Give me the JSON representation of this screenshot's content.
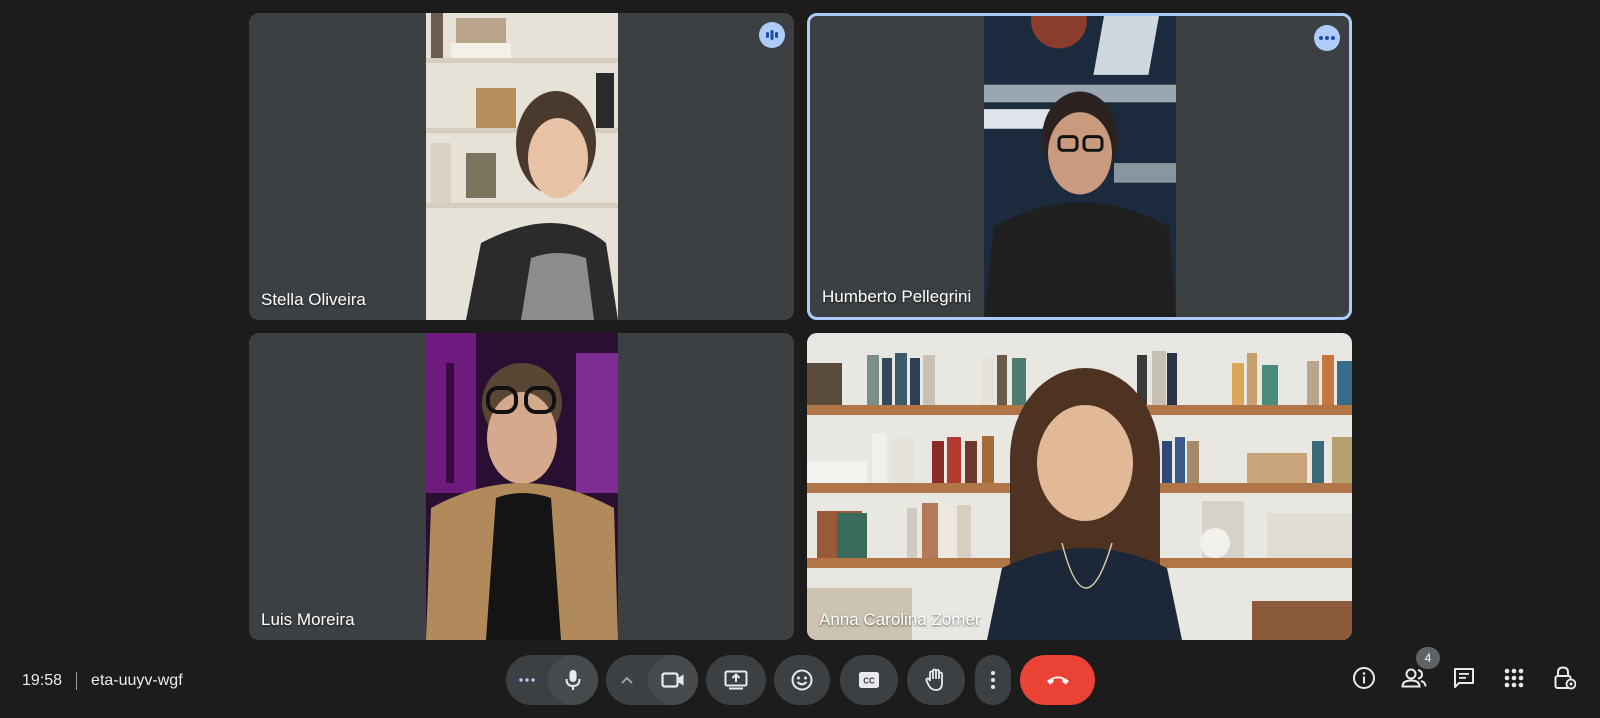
{
  "participants": [
    {
      "name": "Stella Oliveira"
    },
    {
      "name": "Humberto Pellegrini"
    },
    {
      "name": "Luis Moreira"
    },
    {
      "name": "Anna Carolina Zomer"
    }
  ],
  "meeting": {
    "time": "19:58",
    "code": "eta-uuyv-wgf"
  },
  "people_count": "4",
  "colors": {
    "background": "#202124",
    "tile": "#3c4043",
    "active_border": "#aecbfa",
    "end_call": "#ea4335"
  },
  "controls": [
    "more-audio-options-icon",
    "microphone-icon",
    "expand-icon",
    "camera-icon",
    "present-screen-icon",
    "emoji-icon",
    "captions-icon",
    "raise-hand-icon",
    "more-options-icon",
    "end-call-icon"
  ],
  "right_controls": [
    "info-icon",
    "people-icon",
    "chat-icon",
    "activities-icon",
    "host-controls-icon"
  ]
}
